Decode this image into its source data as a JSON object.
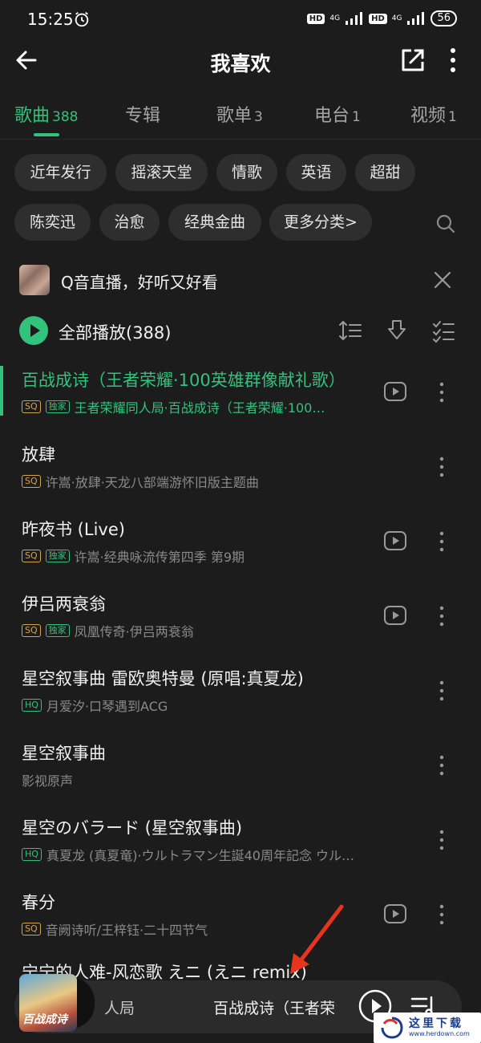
{
  "status_bar": {
    "time": "15:25",
    "hd1": "HD",
    "net1": "4G",
    "hd2": "HD",
    "net2": "4G",
    "battery": "56"
  },
  "header": {
    "title": "我喜欢"
  },
  "tabs": [
    {
      "label": "歌曲",
      "count": "388",
      "active": true
    },
    {
      "label": "专辑",
      "count": "",
      "active": false
    },
    {
      "label": "歌单",
      "count": "3",
      "active": false
    },
    {
      "label": "电台",
      "count": "1",
      "active": false
    },
    {
      "label": "视频",
      "count": "1",
      "active": false
    }
  ],
  "filters": {
    "row1": [
      "近年发行",
      "摇滚天堂",
      "情歌",
      "英语",
      "超甜"
    ],
    "row2": [
      "陈奕迅",
      "治愈",
      "经典金曲",
      "更多分类>"
    ]
  },
  "promo": {
    "text": "Q音直播，好听又好看"
  },
  "play_all": {
    "label": "全部播放(388)"
  },
  "songs": [
    {
      "title": "百战成诗（王者荣耀·100英雄群像献礼歌）",
      "quality": "SQ",
      "exclusive": "独家",
      "subtitle": "王者荣耀同人局·百战成诗（王者荣耀·100…",
      "mv": true,
      "playing": true
    },
    {
      "title": "放肆",
      "quality": "SQ",
      "exclusive": "",
      "subtitle": "许嵩·放肆·天龙八部端游怀旧版主题曲",
      "mv": false,
      "playing": false
    },
    {
      "title": "昨夜书 (Live)",
      "quality": "SQ",
      "exclusive": "独家",
      "subtitle": "许嵩·经典咏流传第四季 第9期",
      "mv": true,
      "playing": false
    },
    {
      "title": "伊吕两衰翁",
      "quality": "SQ",
      "exclusive": "独家",
      "subtitle": "凤凰传奇·伊吕两衰翁",
      "mv": true,
      "playing": false
    },
    {
      "title": "星空叙事曲 雷欧奥特曼 (原唱:真夏龙)",
      "quality": "HQ",
      "exclusive": "",
      "subtitle": "月爱汐·口琴遇到ACG",
      "mv": false,
      "playing": false
    },
    {
      "title": "星空叙事曲",
      "quality": "",
      "exclusive": "",
      "subtitle": "影视原声",
      "mv": false,
      "playing": false
    },
    {
      "title": "星空のバラード (星空叙事曲)",
      "quality": "HQ",
      "exclusive": "",
      "subtitle": "真夏龙 (真夏竜)·ウルトラマン生誕40周年記念 ウルト…",
      "mv": false,
      "playing": false
    },
    {
      "title": "春分",
      "quality": "SQ",
      "exclusive": "",
      "subtitle": "音阙诗听/王梓钰·二十四节气",
      "mv": true,
      "playing": false
    }
  ],
  "partial_song_title": "宁宁的人难-风恋歌 えニ (えニ remix)",
  "mini_player": {
    "cover_text": "百战成诗",
    "artist": "人局",
    "song": "百战成诗（王者荣"
  },
  "watermark": {
    "text": "这里下载",
    "url": "www.herdown.com"
  },
  "colors": {
    "accent": "#31c27c",
    "background": "#1c1c1c",
    "sq_badge": "#d4a54d",
    "annotation_arrow": "#e8331e"
  }
}
